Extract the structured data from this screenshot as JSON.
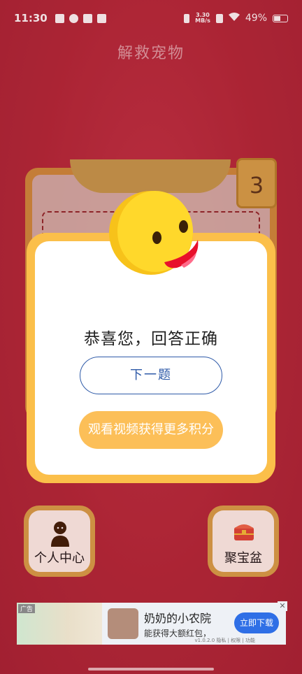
{
  "status_bar": {
    "time": "11:30",
    "net_speed_value": "3.30",
    "net_speed_unit": "MB/s",
    "battery": "49%"
  },
  "page": {
    "title": "解救宠物"
  },
  "level": {
    "number": "3"
  },
  "dialog": {
    "message": "恭喜您，回答正确",
    "next_button": "下一题",
    "video_button": "观看视频获得更多积分"
  },
  "tiles": {
    "personal_center": "个人中心",
    "treasure": "聚宝盆"
  },
  "ad": {
    "tag": "广告",
    "title": "奶奶的小农院",
    "subtitle": "能获得大额红包，",
    "cta": "立即下载",
    "meta": "v1.0.2.0 隐私 | 权限 | 功能"
  },
  "colors": {
    "background": "#b62c3a",
    "dialog_border": "#fbbf4a",
    "next_button_border": "#2e5aa8",
    "video_button": "#fcbf58",
    "face": "#ffd82b"
  }
}
